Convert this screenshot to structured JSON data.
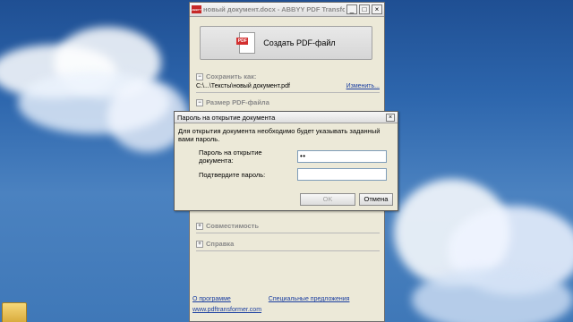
{
  "main_window": {
    "title": "новый документ.docx - ABBYY PDF Transformer",
    "app_icon": "ABBYY",
    "controls": {
      "minimize": "_",
      "maximize": "□",
      "close": "×"
    },
    "create_button": {
      "label": "Создать PDF-файл",
      "icon_tag": "PDF"
    },
    "save_as": {
      "title": "Сохранить как:",
      "toggle": "−",
      "path": "C:\\...\\Тексты\\новый документ.pdf",
      "change_link": "Изменить..."
    },
    "file_size": {
      "title": "Размер PDF-файла",
      "toggle": "−"
    },
    "compatibility": {
      "title": "Совместимость",
      "toggle": "+"
    },
    "help": {
      "title": "Справка",
      "toggle": "+"
    },
    "links": {
      "about": "О программе",
      "offers": "Специальные предложения",
      "site": "www.pdftransformer.com"
    }
  },
  "password_dialog": {
    "title": "Пароль на открытие документа",
    "close": "×",
    "message": "Для открытия документа необходимо будет указывать заданный вами пароль.",
    "password_label": "Пароль на открытие документа:",
    "password_value": "••",
    "confirm_label": "Подтвердите пароль:",
    "confirm_value": "",
    "ok_label": "OK",
    "cancel_label": "Отмена"
  },
  "colors": {
    "sky": "#2d66ad",
    "window": "#ece9d8",
    "link": "#1a3ea0",
    "pdf_red": "#d32f2f"
  }
}
